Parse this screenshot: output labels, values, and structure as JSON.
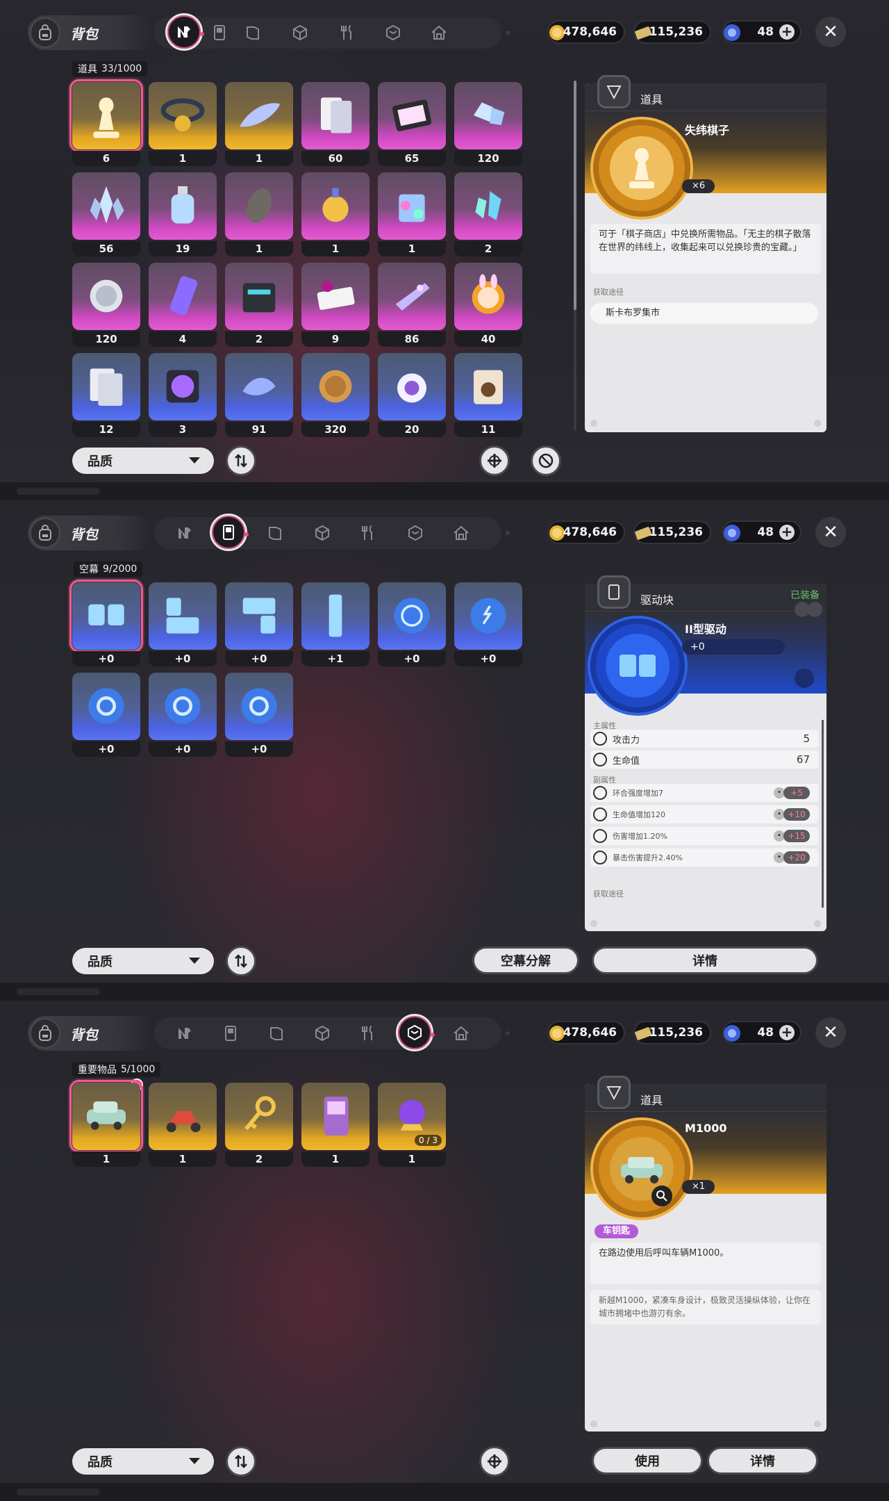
{
  "header": {
    "title": "背包",
    "currencies": [
      {
        "name": "coin",
        "value": "478,646"
      },
      {
        "name": "ticket",
        "value": "115,236"
      },
      {
        "name": "crystal",
        "value": "48"
      }
    ]
  },
  "tab_icons": [
    "n-logo-icon",
    "handheld-icon",
    "book-icon",
    "cube-icon",
    "utensils-icon",
    "cube-shield-icon",
    "house-icon"
  ],
  "panel1": {
    "category": "道具",
    "count": "33/1000",
    "items": [
      {
        "rarity": "gold",
        "icon": "chess-piece-icon",
        "count": "6",
        "selected": true
      },
      {
        "rarity": "gold",
        "icon": "collar-icon",
        "count": "1"
      },
      {
        "rarity": "gold",
        "icon": "surfboard-icon",
        "count": "1"
      },
      {
        "rarity": "purple",
        "icon": "cards-icon",
        "count": "60"
      },
      {
        "rarity": "purple",
        "icon": "tray-icon",
        "count": "65"
      },
      {
        "rarity": "purple",
        "icon": "crystals-icon",
        "count": "120"
      },
      {
        "rarity": "purple",
        "icon": "crystal-cluster-icon",
        "count": "56"
      },
      {
        "rarity": "purple",
        "icon": "bottle-icon",
        "count": "19"
      },
      {
        "rarity": "purple",
        "icon": "seed-icon",
        "count": "1"
      },
      {
        "rarity": "purple",
        "icon": "perfume-icon",
        "count": "1"
      },
      {
        "rarity": "purple",
        "icon": "paint-bucket-icon",
        "count": "1"
      },
      {
        "rarity": "purple",
        "icon": "gem-shards-icon",
        "count": "2"
      },
      {
        "rarity": "purple",
        "icon": "silver-coin-icon",
        "count": "120"
      },
      {
        "rarity": "purple",
        "icon": "energy-can-icon",
        "count": "4"
      },
      {
        "rarity": "purple",
        "icon": "radio-box-icon",
        "count": "2"
      },
      {
        "rarity": "purple",
        "icon": "tickets-icon",
        "count": "9"
      },
      {
        "rarity": "purple",
        "icon": "glitter-icon",
        "count": "86"
      },
      {
        "rarity": "purple",
        "icon": "bunny-badge-icon",
        "count": "40"
      },
      {
        "rarity": "blue",
        "icon": "documents-icon",
        "count": "12"
      },
      {
        "rarity": "blue",
        "icon": "disc-icon",
        "count": "3"
      },
      {
        "rarity": "blue",
        "icon": "fish-icon",
        "count": "91"
      },
      {
        "rarity": "blue",
        "icon": "bronze-coin-icon",
        "count": "320"
      },
      {
        "rarity": "blue",
        "icon": "eye-orb-icon",
        "count": "20"
      },
      {
        "rarity": "blue",
        "icon": "snack-bag-icon",
        "count": "11"
      }
    ],
    "quality_label": "品质",
    "detail": {
      "category": "道具",
      "name": "失纬棋子",
      "quantity": "×6",
      "description": "可于「棋子商店」中兑换所需物品。「无主的棋子散落在世界的纬线上，收集起来可以兑换珍贵的宝藏。」",
      "source_label": "获取途径",
      "source": "斯卡布罗集市"
    }
  },
  "panel2": {
    "category": "空幕",
    "count": "9/2000",
    "items": [
      {
        "rarity": "blue",
        "icon": "domino-icon",
        "count": "+0",
        "selected": true
      },
      {
        "rarity": "blue",
        "icon": "l-block-icon",
        "count": "+0"
      },
      {
        "rarity": "blue",
        "icon": "j-block-icon",
        "count": "+0"
      },
      {
        "rarity": "blue",
        "icon": "i-block-icon",
        "count": "+1"
      },
      {
        "rarity": "blue",
        "icon": "compass-disc-icon",
        "count": "+0"
      },
      {
        "rarity": "blue",
        "icon": "bolt-disc-icon",
        "count": "+0"
      },
      {
        "rarity": "blue",
        "icon": "ring-disc-icon",
        "count": "+0"
      },
      {
        "rarity": "blue",
        "icon": "ring-disc-icon",
        "count": "+0"
      },
      {
        "rarity": "blue",
        "icon": "ring-disc-icon",
        "count": "+0"
      }
    ],
    "quality_label": "品质",
    "decompose_label": "空幕分解",
    "details_label": "详情",
    "detail": {
      "category": "驱动块",
      "equipped": "已装备",
      "name": "II型驱动",
      "level": "+0",
      "main_label": "主属性",
      "main_attrs": [
        {
          "icon": "attack-icon",
          "name": "攻击力",
          "value": "5"
        },
        {
          "icon": "heart-icon",
          "name": "生命值",
          "value": "67"
        }
      ],
      "sub_label": "副属性",
      "sub_attrs": [
        {
          "icon": "diamond-icon",
          "name": "环合强度增加7",
          "bonus": "+5"
        },
        {
          "icon": "heart-icon",
          "name": "生命值增加120",
          "bonus": "+10"
        },
        {
          "icon": "triangle-icon",
          "name": "伤害增加1.20%",
          "bonus": "+15"
        },
        {
          "icon": "diamond-icon",
          "name": "暴击伤害提升2.40%",
          "bonus": "+20"
        }
      ],
      "source_label": "获取途径"
    }
  },
  "panel3": {
    "category": "重要物品",
    "count": "5/1000",
    "items": [
      {
        "rarity": "gold",
        "icon": "car-icon",
        "count": "1",
        "selected": true
      },
      {
        "rarity": "gold",
        "icon": "scooter-icon",
        "count": "1"
      },
      {
        "rarity": "gold",
        "icon": "key-icon",
        "count": "2"
      },
      {
        "rarity": "gold",
        "icon": "music-player-icon",
        "count": "1"
      },
      {
        "rarity": "gold",
        "icon": "orb-icon",
        "count": "1",
        "progress": "0 / 3"
      }
    ],
    "quality_label": "品质",
    "use_label": "使用",
    "details_label": "详情",
    "detail": {
      "category": "道具",
      "name": "M1000",
      "quantity": "×1",
      "tag": "车钥匙",
      "usage": "在路边使用后呼叫车辆M1000。",
      "flavor": "新越M1000，紧凑车身设计，极致灵活操纵体验，让你在城市拥堵中也游刃有余。"
    }
  },
  "colors": {
    "gold": "#e1a623",
    "purple": "#d049c3",
    "blue": "#4c63e3",
    "accent": "#ef5a8f"
  }
}
